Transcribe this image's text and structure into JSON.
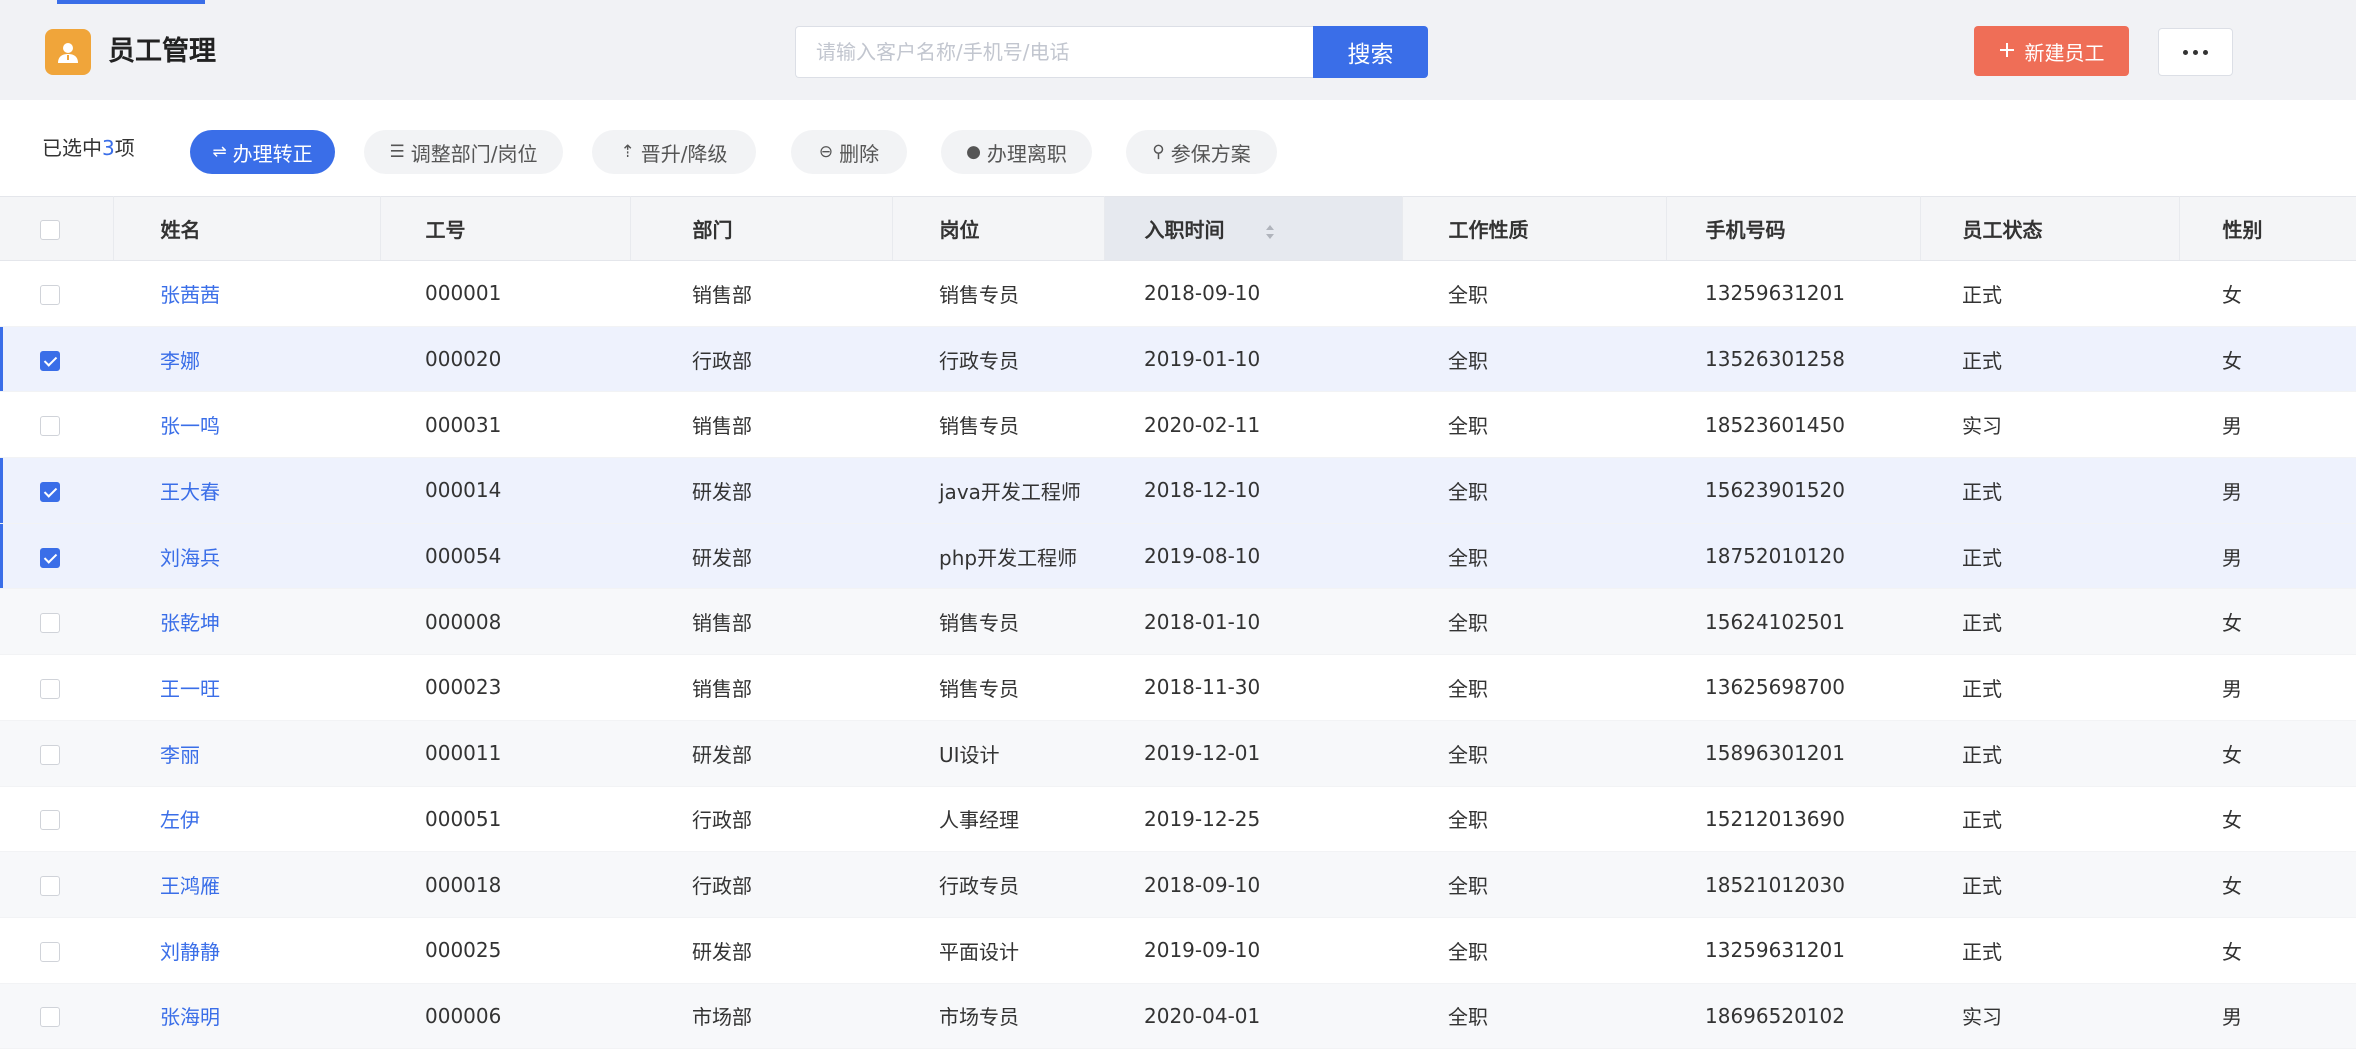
{
  "header": {
    "title": "员工管理",
    "search_placeholder": "请输入客户名称/手机号/电话",
    "search_button": "搜索",
    "new_button": "新建员工",
    "more_icon": "more-icon"
  },
  "action_bar": {
    "selected_prefix": "已选中",
    "selected_count": "3",
    "selected_suffix": "项",
    "actions": [
      {
        "label": "办理转正",
        "icon": "swap-icon"
      },
      {
        "label": "调整部门/岗位",
        "icon": "adjust-icon"
      },
      {
        "label": "晋升/降级",
        "icon": "promote-icon"
      },
      {
        "label": "删除",
        "icon": "delete-icon"
      },
      {
        "label": "办理离职",
        "icon": "resign-icon"
      },
      {
        "label": "参保方案",
        "icon": "location-icon"
      }
    ]
  },
  "table": {
    "columns": [
      "姓名",
      "工号",
      "部门",
      "岗位",
      "入职时间",
      "工作性质",
      "手机号码",
      "员工状态",
      "性别"
    ],
    "rows": [
      {
        "checked": false,
        "name": "张茜茜",
        "id": "000001",
        "dept": "销售部",
        "position": "销售专员",
        "hire_date": "2018-09-10",
        "type": "全职",
        "phone": "13259631201",
        "status": "正式",
        "gender": "女"
      },
      {
        "checked": true,
        "name": "李娜",
        "id": "000020",
        "dept": "行政部",
        "position": "行政专员",
        "hire_date": "2019-01-10",
        "type": "全职",
        "phone": "13526301258",
        "status": "正式",
        "gender": "女"
      },
      {
        "checked": false,
        "name": "张一鸣",
        "id": "000031",
        "dept": "销售部",
        "position": "销售专员",
        "hire_date": "2020-02-11",
        "type": "全职",
        "phone": "18523601450",
        "status": "实习",
        "gender": "男"
      },
      {
        "checked": true,
        "name": "王大春",
        "id": "000014",
        "dept": "研发部",
        "position": "java开发工程师",
        "hire_date": "2018-12-10",
        "type": "全职",
        "phone": "15623901520",
        "status": "正式",
        "gender": "男"
      },
      {
        "checked": true,
        "name": "刘海兵",
        "id": "000054",
        "dept": "研发部",
        "position": "php开发工程师",
        "hire_date": "2019-08-10",
        "type": "全职",
        "phone": "18752010120",
        "status": "正式",
        "gender": "男"
      },
      {
        "checked": false,
        "name": "张乾坤",
        "id": "000008",
        "dept": "销售部",
        "position": "销售专员",
        "hire_date": "2018-01-10",
        "type": "全职",
        "phone": "15624102501",
        "status": "正式",
        "gender": "女"
      },
      {
        "checked": false,
        "name": "王一旺",
        "id": "000023",
        "dept": "销售部",
        "position": "销售专员",
        "hire_date": "2018-11-30",
        "type": "全职",
        "phone": "13625698700",
        "status": "正式",
        "gender": "男"
      },
      {
        "checked": false,
        "name": "李丽",
        "id": "000011",
        "dept": "研发部",
        "position": "UI设计",
        "hire_date": "2019-12-01",
        "type": "全职",
        "phone": "15896301201",
        "status": "正式",
        "gender": "女"
      },
      {
        "checked": false,
        "name": "左伊",
        "id": "000051",
        "dept": "行政部",
        "position": "人事经理",
        "hire_date": "2019-12-25",
        "type": "全职",
        "phone": "15212013690",
        "status": "正式",
        "gender": "女"
      },
      {
        "checked": false,
        "name": "王鸿雁",
        "id": "000018",
        "dept": "行政部",
        "position": "行政专员",
        "hire_date": "2018-09-10",
        "type": "全职",
        "phone": "18521012030",
        "status": "正式",
        "gender": "女"
      },
      {
        "checked": false,
        "name": "刘静静",
        "id": "000025",
        "dept": "研发部",
        "position": "平面设计",
        "hire_date": "2019-09-10",
        "type": "全职",
        "phone": "13259631201",
        "status": "正式",
        "gender": "女"
      },
      {
        "checked": false,
        "name": "张海明",
        "id": "000006",
        "dept": "市场部",
        "position": "市场专员",
        "hire_date": "2020-04-01",
        "type": "全职",
        "phone": "18696520102",
        "status": "实习",
        "gender": "男"
      }
    ]
  },
  "colors": {
    "accent": "#3a6ee8",
    "new_button": "#ef6e57",
    "logo": "#f0a53a"
  }
}
